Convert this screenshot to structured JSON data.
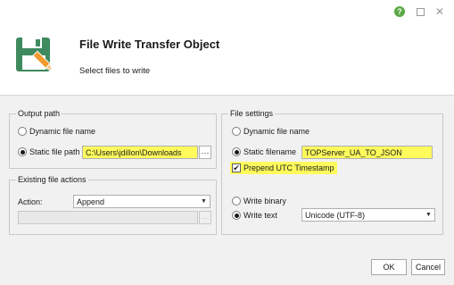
{
  "titlebar": {
    "help_label": "?",
    "close_label": "✕"
  },
  "header": {
    "title": "File Write Transfer Object",
    "subtitle": "Select files to write",
    "logo_icon": "floppy-disk-pencil-icon",
    "logo_color": "#3f8a5f",
    "pencil_color": "#f29a2e"
  },
  "output_path": {
    "legend": "Output path",
    "dynamic_label": "Dynamic file name",
    "static_label": "Static file path",
    "static_value": "C:\\Users\\jdillon\\Downloads",
    "selected": "static",
    "browse_label": "···"
  },
  "existing": {
    "legend": "Existing file actions",
    "action_label": "Action:",
    "action_value": "Append",
    "path_value": "",
    "browse_label": "···"
  },
  "file_settings": {
    "legend": "File settings",
    "dynamic_label": "Dynamic file name",
    "static_label": "Static filename",
    "static_value": "TOPServer_UA_TO_JSON",
    "prepend_label": "Prepend UTC Timestamp",
    "prepend_checked": true,
    "write_binary_label": "Write binary",
    "write_text_label": "Write text",
    "encoding_value": "Unicode (UTF-8)",
    "write_mode": "text"
  },
  "buttons": {
    "ok": "OK",
    "cancel": "Cancel"
  },
  "colors": {
    "highlight": "#fffb5c",
    "body_bg": "#f1f1f1"
  }
}
